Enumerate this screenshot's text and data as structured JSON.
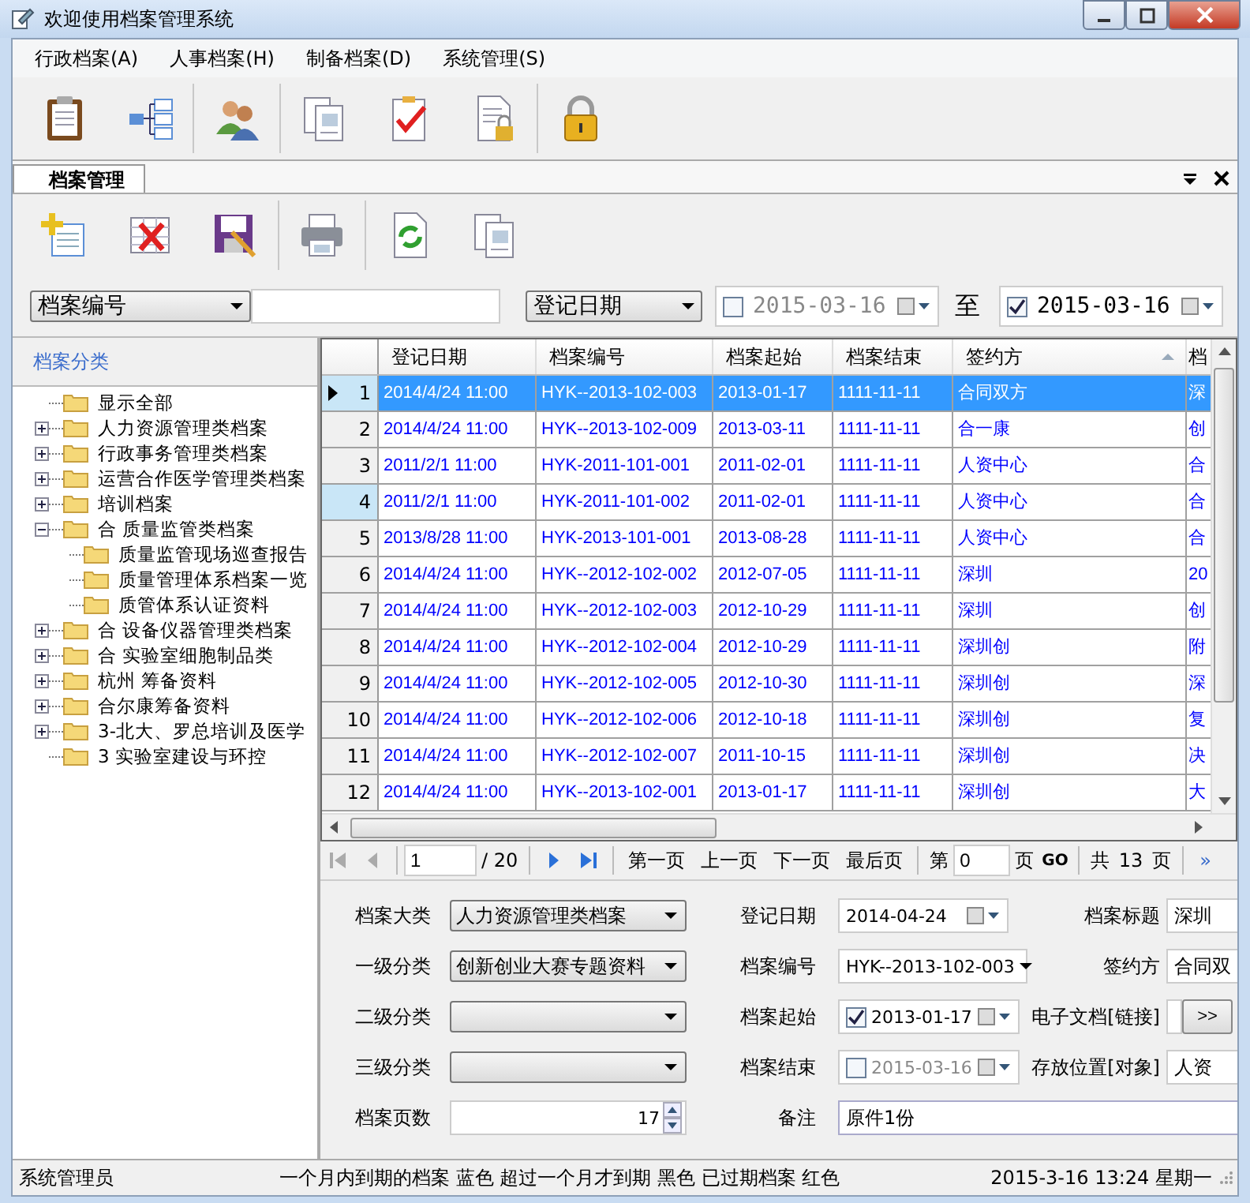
{
  "window": {
    "title": "欢迎使用档案管理系统"
  },
  "menu": [
    {
      "label": "行政档案(A)"
    },
    {
      "label": "人事档案(H)"
    },
    {
      "label": "制备档案(D)"
    },
    {
      "label": "系统管理(S)"
    }
  ],
  "tab": {
    "label": "档案管理",
    "selected": true
  },
  "search": {
    "field": "档案编号",
    "date_field": "登记日期",
    "from": {
      "checked": false,
      "value": "2015-03-16"
    },
    "to_label": "至",
    "to": {
      "checked": true,
      "value": "2015-03-16"
    }
  },
  "tree": {
    "title": "档案分类",
    "items": [
      {
        "label": "显示全部",
        "kind": "leaf"
      },
      {
        "label": "人力资源管理类档案",
        "kind": "group",
        "expanded": false
      },
      {
        "label": "行政事务管理类档案",
        "kind": "group",
        "expanded": false
      },
      {
        "label": "运营合作医学管理类档案",
        "kind": "group",
        "expanded": false
      },
      {
        "label": "培训档案",
        "kind": "group",
        "expanded": false
      },
      {
        "label": "合 质量监管类档案",
        "kind": "group",
        "expanded": true,
        "children": [
          {
            "label": "质量监管现场巡查报告"
          },
          {
            "label": "质量管理体系档案一览"
          },
          {
            "label": "质管体系认证资料"
          }
        ]
      },
      {
        "label": "合 设备仪器管理类档案",
        "kind": "group",
        "expanded": false
      },
      {
        "label": "合 实验室细胞制品类",
        "kind": "group",
        "expanded": false
      },
      {
        "label": "杭州 筹备资料",
        "kind": "group",
        "expanded": false
      },
      {
        "label": "合尔康筹备资料",
        "kind": "group",
        "expanded": false
      },
      {
        "label": "3-北大、罗总培训及医学",
        "kind": "group",
        "expanded": false
      },
      {
        "label": "3 实验室建设与环控",
        "kind": "leaf"
      }
    ]
  },
  "table": {
    "columns": [
      "登记日期",
      "档案编号",
      "档案起始",
      "档案结束",
      "签约方",
      "档"
    ],
    "rows": [
      {
        "number": "1",
        "selected": true,
        "current": true,
        "cells": [
          "2014/4/24 11:00",
          "HYK--2013-102-003",
          "2013-01-17",
          "1111-11-11",
          "合同双方",
          "深"
        ]
      },
      {
        "number": "2",
        "selected": false,
        "current": false,
        "cells": [
          "2014/4/24 11:00",
          "HYK--2013-102-009",
          "2013-03-11",
          "1111-11-11",
          "合一康",
          "创"
        ]
      },
      {
        "number": "3",
        "selected": false,
        "current": false,
        "cells": [
          "2011/2/1 11:00",
          "HYK-2011-101-001",
          "2011-02-01",
          "1111-11-11",
          "人资中心",
          "合"
        ]
      },
      {
        "number": "4",
        "selected": false,
        "current": true,
        "cells": [
          "2011/2/1 11:00",
          "HYK-2011-101-002",
          "2011-02-01",
          "1111-11-11",
          "人资中心",
          "合"
        ]
      },
      {
        "number": "5",
        "selected": false,
        "current": false,
        "cells": [
          "2013/8/28 11:00",
          "HYK-2013-101-001",
          "2013-08-28",
          "1111-11-11",
          "人资中心",
          "合"
        ]
      },
      {
        "number": "6",
        "selected": false,
        "current": false,
        "cells": [
          "2014/4/24 11:00",
          "HYK--2012-102-002",
          "2012-07-05",
          "1111-11-11",
          "深圳",
          "20"
        ]
      },
      {
        "number": "7",
        "selected": false,
        "current": false,
        "cells": [
          "2014/4/24 11:00",
          "HYK--2012-102-003",
          "2012-10-29",
          "1111-11-11",
          "深圳",
          "创"
        ]
      },
      {
        "number": "8",
        "selected": false,
        "current": false,
        "cells": [
          "2014/4/24 11:00",
          "HYK--2012-102-004",
          "2012-10-29",
          "1111-11-11",
          "深圳创",
          "附"
        ]
      },
      {
        "number": "9",
        "selected": false,
        "current": false,
        "cells": [
          "2014/4/24 11:00",
          "HYK--2012-102-005",
          "2012-10-30",
          "1111-11-11",
          "深圳创",
          "深"
        ]
      },
      {
        "number": "10",
        "selected": false,
        "current": false,
        "cells": [
          "2014/4/24 11:00",
          "HYK--2012-102-006",
          "2012-10-18",
          "1111-11-11",
          "深圳创",
          "复"
        ]
      },
      {
        "number": "11",
        "selected": false,
        "current": false,
        "cells": [
          "2014/4/24 11:00",
          "HYK--2012-102-007",
          "2011-10-15",
          "1111-11-11",
          "深圳创",
          "决"
        ]
      },
      {
        "number": "12",
        "selected": false,
        "current": false,
        "cells": [
          "2014/4/24 11:00",
          "HYK--2013-102-001",
          "2013-01-17",
          "1111-11-11",
          "深圳创",
          "大"
        ]
      }
    ]
  },
  "pager": {
    "page": "1",
    "total": "/ 20",
    "links": [
      "第一页",
      "上一页",
      "下一页",
      "最后页"
    ],
    "goto_prefix": "第",
    "goto_value": "0",
    "goto_suffix": "页",
    "go": "GO",
    "count_prefix": "共",
    "count": "13",
    "count_suffix": "页",
    "more": "»"
  },
  "form": {
    "rows": [
      [
        {
          "label": "档案大类",
          "kind": "dropdown",
          "value": "人力资源管理类档案"
        },
        {
          "label": "登记日期",
          "kind": "date",
          "value": "2014-04-24"
        },
        {
          "label": "档案标题",
          "kind": "text",
          "value": "深圳"
        }
      ],
      [
        {
          "label": "一级分类",
          "kind": "dropdown",
          "value": "创新创业大赛专题资料"
        },
        {
          "label": "档案编号",
          "kind": "combo",
          "value": "HYK--2013-102-003"
        },
        {
          "label": "签约方",
          "kind": "text",
          "value": "合同双"
        }
      ],
      [
        {
          "label": "二级分类",
          "kind": "dropdown"
        },
        {
          "label": "档案起始",
          "kind": "checkdate",
          "checked": true,
          "value": "2013-01-17"
        },
        {
          "label": "电子文档[链接]",
          "kind": "link",
          "value": ">>"
        }
      ],
      [
        {
          "label": "三级分类",
          "kind": "dropdown"
        },
        {
          "label": "档案结束",
          "kind": "checkdate",
          "checked": false,
          "value": "2015-03-16"
        },
        {
          "label": "存放位置[对象]",
          "kind": "text",
          "value": "人资"
        }
      ],
      [
        {
          "label": "档案页数",
          "kind": "spinner",
          "value": "17"
        },
        {
          "label": "备注",
          "kind": "note",
          "value": "原件1份"
        }
      ]
    ]
  },
  "status_bar": {
    "user": "系统管理员",
    "legend": "一个月内到期的档案 蓝色 超过一个月才到期 黑色 已过期档案 红色",
    "datetime": "2015-3-16 13:24 星期一"
  }
}
